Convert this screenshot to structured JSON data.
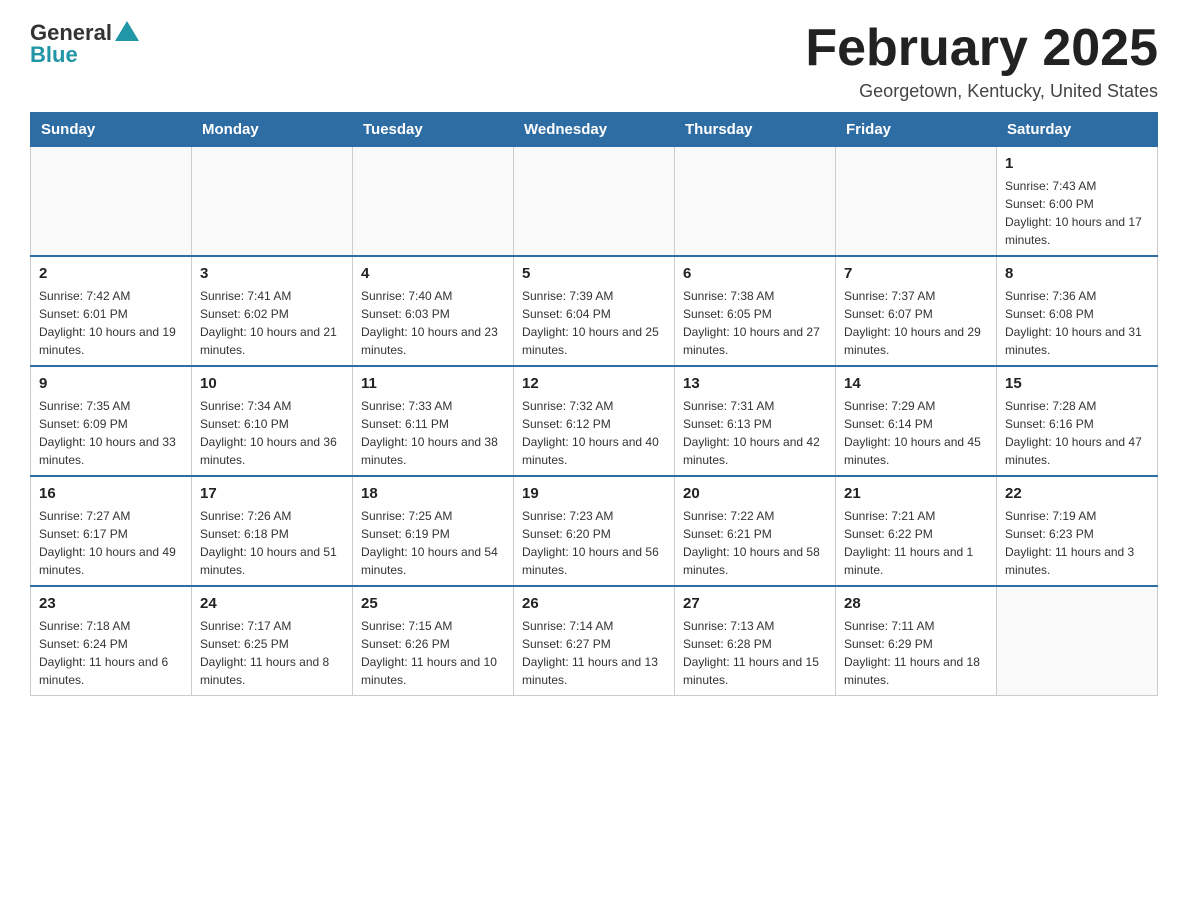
{
  "header": {
    "logo_general": "General",
    "logo_blue": "Blue",
    "month_title": "February 2025",
    "location": "Georgetown, Kentucky, United States"
  },
  "days_of_week": [
    "Sunday",
    "Monday",
    "Tuesday",
    "Wednesday",
    "Thursday",
    "Friday",
    "Saturday"
  ],
  "weeks": [
    [
      {
        "day": "",
        "info": ""
      },
      {
        "day": "",
        "info": ""
      },
      {
        "day": "",
        "info": ""
      },
      {
        "day": "",
        "info": ""
      },
      {
        "day": "",
        "info": ""
      },
      {
        "day": "",
        "info": ""
      },
      {
        "day": "1",
        "info": "Sunrise: 7:43 AM\nSunset: 6:00 PM\nDaylight: 10 hours and 17 minutes."
      }
    ],
    [
      {
        "day": "2",
        "info": "Sunrise: 7:42 AM\nSunset: 6:01 PM\nDaylight: 10 hours and 19 minutes."
      },
      {
        "day": "3",
        "info": "Sunrise: 7:41 AM\nSunset: 6:02 PM\nDaylight: 10 hours and 21 minutes."
      },
      {
        "day": "4",
        "info": "Sunrise: 7:40 AM\nSunset: 6:03 PM\nDaylight: 10 hours and 23 minutes."
      },
      {
        "day": "5",
        "info": "Sunrise: 7:39 AM\nSunset: 6:04 PM\nDaylight: 10 hours and 25 minutes."
      },
      {
        "day": "6",
        "info": "Sunrise: 7:38 AM\nSunset: 6:05 PM\nDaylight: 10 hours and 27 minutes."
      },
      {
        "day": "7",
        "info": "Sunrise: 7:37 AM\nSunset: 6:07 PM\nDaylight: 10 hours and 29 minutes."
      },
      {
        "day": "8",
        "info": "Sunrise: 7:36 AM\nSunset: 6:08 PM\nDaylight: 10 hours and 31 minutes."
      }
    ],
    [
      {
        "day": "9",
        "info": "Sunrise: 7:35 AM\nSunset: 6:09 PM\nDaylight: 10 hours and 33 minutes."
      },
      {
        "day": "10",
        "info": "Sunrise: 7:34 AM\nSunset: 6:10 PM\nDaylight: 10 hours and 36 minutes."
      },
      {
        "day": "11",
        "info": "Sunrise: 7:33 AM\nSunset: 6:11 PM\nDaylight: 10 hours and 38 minutes."
      },
      {
        "day": "12",
        "info": "Sunrise: 7:32 AM\nSunset: 6:12 PM\nDaylight: 10 hours and 40 minutes."
      },
      {
        "day": "13",
        "info": "Sunrise: 7:31 AM\nSunset: 6:13 PM\nDaylight: 10 hours and 42 minutes."
      },
      {
        "day": "14",
        "info": "Sunrise: 7:29 AM\nSunset: 6:14 PM\nDaylight: 10 hours and 45 minutes."
      },
      {
        "day": "15",
        "info": "Sunrise: 7:28 AM\nSunset: 6:16 PM\nDaylight: 10 hours and 47 minutes."
      }
    ],
    [
      {
        "day": "16",
        "info": "Sunrise: 7:27 AM\nSunset: 6:17 PM\nDaylight: 10 hours and 49 minutes."
      },
      {
        "day": "17",
        "info": "Sunrise: 7:26 AM\nSunset: 6:18 PM\nDaylight: 10 hours and 51 minutes."
      },
      {
        "day": "18",
        "info": "Sunrise: 7:25 AM\nSunset: 6:19 PM\nDaylight: 10 hours and 54 minutes."
      },
      {
        "day": "19",
        "info": "Sunrise: 7:23 AM\nSunset: 6:20 PM\nDaylight: 10 hours and 56 minutes."
      },
      {
        "day": "20",
        "info": "Sunrise: 7:22 AM\nSunset: 6:21 PM\nDaylight: 10 hours and 58 minutes."
      },
      {
        "day": "21",
        "info": "Sunrise: 7:21 AM\nSunset: 6:22 PM\nDaylight: 11 hours and 1 minute."
      },
      {
        "day": "22",
        "info": "Sunrise: 7:19 AM\nSunset: 6:23 PM\nDaylight: 11 hours and 3 minutes."
      }
    ],
    [
      {
        "day": "23",
        "info": "Sunrise: 7:18 AM\nSunset: 6:24 PM\nDaylight: 11 hours and 6 minutes."
      },
      {
        "day": "24",
        "info": "Sunrise: 7:17 AM\nSunset: 6:25 PM\nDaylight: 11 hours and 8 minutes."
      },
      {
        "day": "25",
        "info": "Sunrise: 7:15 AM\nSunset: 6:26 PM\nDaylight: 11 hours and 10 minutes."
      },
      {
        "day": "26",
        "info": "Sunrise: 7:14 AM\nSunset: 6:27 PM\nDaylight: 11 hours and 13 minutes."
      },
      {
        "day": "27",
        "info": "Sunrise: 7:13 AM\nSunset: 6:28 PM\nDaylight: 11 hours and 15 minutes."
      },
      {
        "day": "28",
        "info": "Sunrise: 7:11 AM\nSunset: 6:29 PM\nDaylight: 11 hours and 18 minutes."
      },
      {
        "day": "",
        "info": ""
      }
    ]
  ]
}
